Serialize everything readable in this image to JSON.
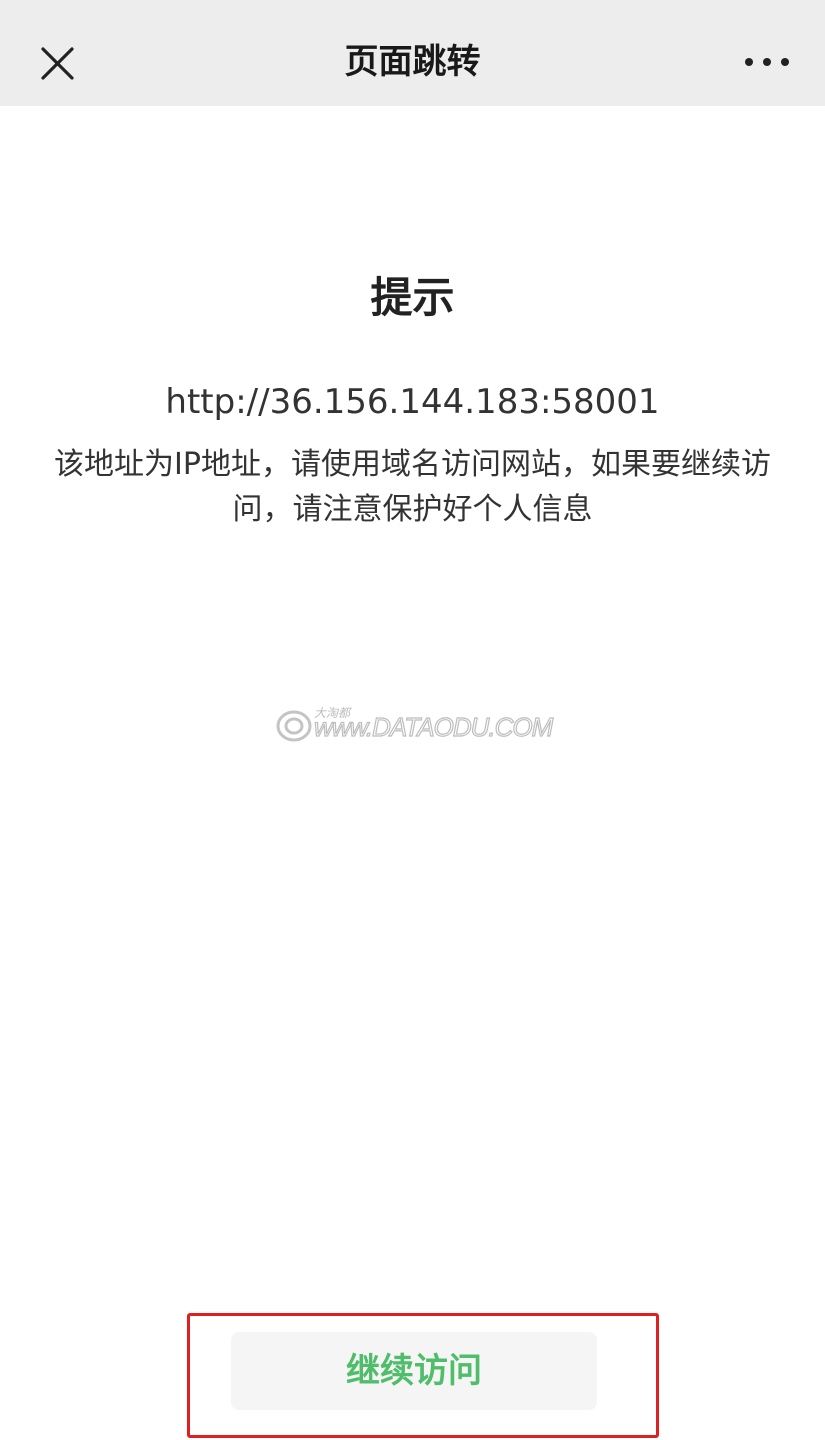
{
  "navbar": {
    "title": "页面跳转",
    "close_icon": "close-icon",
    "more_icon": "more-dots-icon"
  },
  "content": {
    "heading": "提示",
    "url": "http://36.156.144.183:58001",
    "message": "该地址为IP地址，请使用域名访问网站，如果要继续访问，请注意保护好个人信息"
  },
  "watermark": {
    "small_text": "大淘都",
    "url_text": "www.DATAODU.COM"
  },
  "footer": {
    "continue_label": "继续访问"
  },
  "colors": {
    "navbar_bg": "#ededed",
    "button_text": "#4fbd6a",
    "highlight_border": "#e02020"
  }
}
